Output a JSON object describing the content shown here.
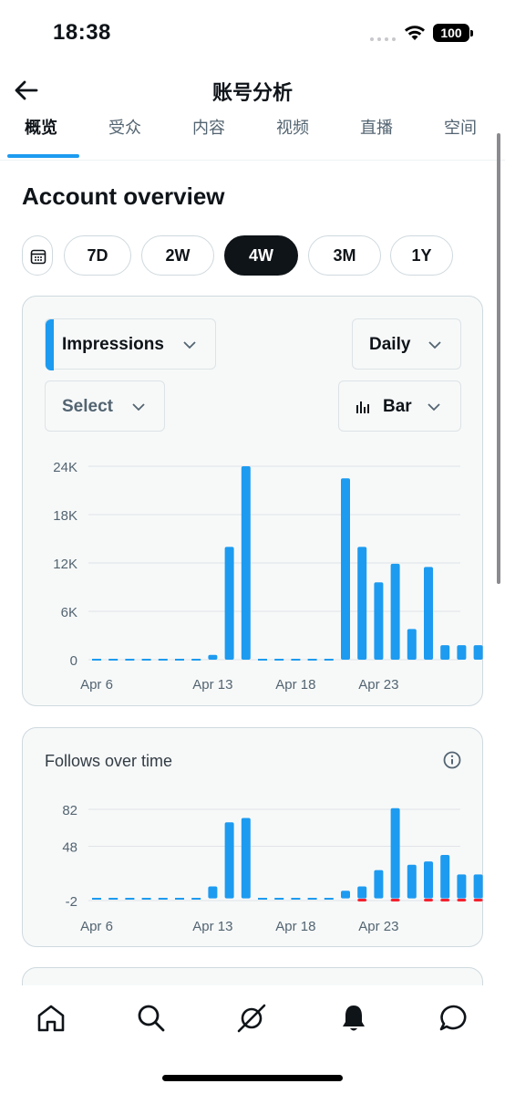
{
  "status": {
    "time": "18:38",
    "battery": "100"
  },
  "header": {
    "title": "账号分析",
    "back_icon": "arrow-left-icon"
  },
  "tabs": [
    {
      "label": "概览",
      "active": true
    },
    {
      "label": "受众",
      "active": false
    },
    {
      "label": "内容",
      "active": false
    },
    {
      "label": "视频",
      "active": false
    },
    {
      "label": "直播",
      "active": false
    },
    {
      "label": "空间",
      "active": false
    }
  ],
  "overview": {
    "title": "Account overview",
    "ranges": [
      "7D",
      "2W",
      "4W",
      "3M",
      "1Y"
    ],
    "selected_range": "4W"
  },
  "main_card": {
    "metric_dropdown": "Impressions",
    "granularity_dropdown": "Daily",
    "compare_dropdown": "Select",
    "chart_type_dropdown": "Bar"
  },
  "follows_card": {
    "title": "Follows over time"
  },
  "colors": {
    "accent": "#1d9bf0",
    "negative": "#f4212e",
    "text": "#0f1419",
    "muted": "#536471"
  },
  "icons": [
    "calendar-icon",
    "chevron-down-icon",
    "bar-chart-icon",
    "info-icon",
    "home-icon",
    "search-icon",
    "grok-icon",
    "bell-icon",
    "message-icon"
  ],
  "chart_data": [
    {
      "type": "bar",
      "title": "",
      "xlabel": "",
      "ylabel": "",
      "x_ticks": [
        "Apr 6",
        "Apr 13",
        "Apr 18",
        "Apr 23"
      ],
      "y_ticks": [
        "0",
        "6K",
        "12K",
        "18K",
        "24K"
      ],
      "ylim": [
        0,
        24000
      ],
      "grid": true,
      "categories": [
        "Apr 6",
        "Apr 7",
        "Apr 8",
        "Apr 9",
        "Apr 10",
        "Apr 11",
        "Apr 12",
        "Apr 13",
        "Apr 14",
        "Apr 15",
        "Apr 16",
        "Apr 17",
        "Apr 18",
        "Apr 19",
        "Apr 20",
        "Apr 21",
        "Apr 22",
        "Apr 23",
        "Apr 24",
        "Apr 25",
        "Apr 26",
        "Apr 27",
        "Apr 28",
        "Apr 29"
      ],
      "series": [
        {
          "values": [
            0,
            0,
            0,
            0,
            0,
            0,
            0,
            600,
            14000,
            24000,
            0,
            0,
            0,
            0,
            0,
            22500,
            14000,
            9600,
            11900,
            3800,
            11500,
            1800,
            1800,
            1800
          ]
        }
      ]
    },
    {
      "type": "bar",
      "title": "Follows over time",
      "xlabel": "",
      "ylabel": "",
      "x_ticks": [
        "Apr 6",
        "Apr 13",
        "Apr 18",
        "Apr 23"
      ],
      "y_ticks": [
        "-2",
        "48",
        "82"
      ],
      "ylim": [
        -2,
        82
      ],
      "grid": true,
      "categories": [
        "Apr 6",
        "Apr 7",
        "Apr 8",
        "Apr 9",
        "Apr 10",
        "Apr 11",
        "Apr 12",
        "Apr 13",
        "Apr 14",
        "Apr 15",
        "Apr 16",
        "Apr 17",
        "Apr 18",
        "Apr 19",
        "Apr 20",
        "Apr 21",
        "Apr 22",
        "Apr 23",
        "Apr 24",
        "Apr 25",
        "Apr 26",
        "Apr 27",
        "Apr 28",
        "Apr 29"
      ],
      "series": [
        {
          "values": [
            0,
            0,
            0,
            0,
            0,
            0,
            0,
            11,
            70,
            74,
            0,
            0,
            0,
            0,
            0,
            7,
            11,
            26,
            83,
            31,
            34,
            40,
            22,
            22
          ]
        },
        {
          "values": [
            0,
            0,
            0,
            0,
            0,
            0,
            0,
            0,
            0,
            0,
            0,
            0,
            0,
            0,
            0,
            0,
            -1,
            0,
            -2,
            0,
            -1,
            -1,
            -1,
            -1
          ]
        }
      ]
    }
  ]
}
